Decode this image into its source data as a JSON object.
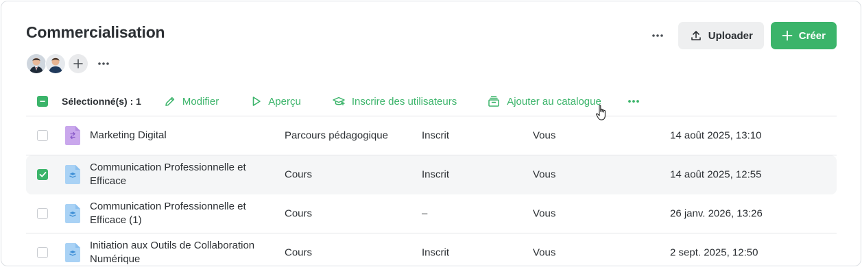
{
  "page": {
    "title": "Commercialisation"
  },
  "members": {
    "avatars": [
      "avatar-man-suit",
      "avatar-man"
    ],
    "add_icon": "plus-icon",
    "more_icon": "more-horizontal-icon"
  },
  "header_actions": {
    "more_icon": "more-horizontal-icon",
    "upload_label": "Uploader",
    "upload_icon": "upload-icon",
    "create_label": "Créer",
    "create_icon": "plus-icon"
  },
  "toolbar": {
    "selected_label": "Sélectionné(s) : 1",
    "actions": [
      {
        "label": "Modifier",
        "icon": "pencil-icon"
      },
      {
        "label": "Aperçu",
        "icon": "play-icon"
      },
      {
        "label": "Inscrire des utilisateurs",
        "icon": "graduation-cap-icon"
      },
      {
        "label": "Ajouter au catalogue",
        "icon": "catalog-icon"
      }
    ],
    "more_icon": "more-horizontal-icon"
  },
  "rows": [
    {
      "name": "Marketing Digital",
      "type": "Parcours pédagogique",
      "status": "Inscrit",
      "owner": "Vous",
      "date": "14 août 2025, 13:10",
      "icon": "learning-path-icon",
      "checked": false
    },
    {
      "name": "Communication Professionnelle et Efficace",
      "type": "Cours",
      "status": "Inscrit",
      "owner": "Vous",
      "date": "14 août 2025, 12:55",
      "icon": "course-icon",
      "checked": true
    },
    {
      "name": "Communication Professionnelle et Efficace (1)",
      "type": "Cours",
      "status": "–",
      "owner": "Vous",
      "date": "26 janv. 2026, 13:26",
      "icon": "course-icon",
      "checked": false
    },
    {
      "name": "Initiation aux Outils de Collaboration Numérique",
      "type": "Cours",
      "status": "Inscrit",
      "owner": "Vous",
      "date": "2 sept. 2025, 12:50",
      "icon": "course-icon",
      "checked": false
    }
  ],
  "colors": {
    "accent": "#3bb46a",
    "path_icon": "#c9a7ec",
    "course_icon": "#a9d2f5",
    "row_selected_bg": "#f5f6f7"
  }
}
